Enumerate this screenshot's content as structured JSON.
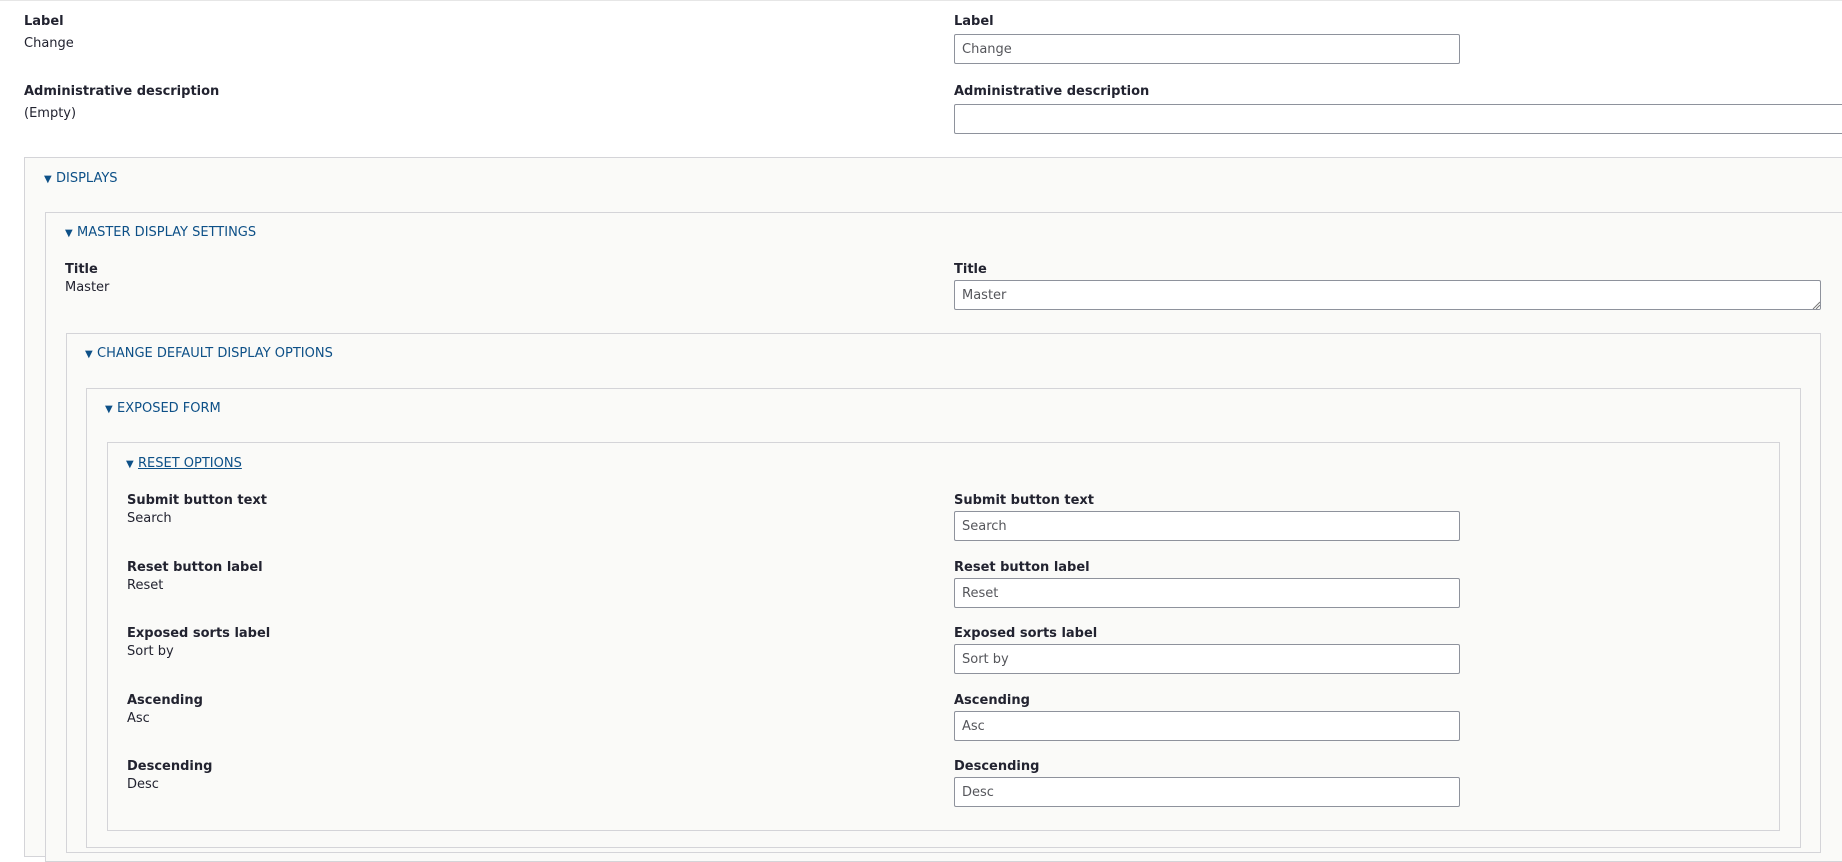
{
  "label": {
    "title": "Label",
    "value": "Change",
    "field_label": "Label",
    "field_value": "Change"
  },
  "admin_description": {
    "title": "Administrative description",
    "value": "(Empty)",
    "field_label": "Administrative description",
    "field_value": ""
  },
  "displays": {
    "summary": "DISPLAYS",
    "master": {
      "summary": "MASTER DISPLAY SETTINGS",
      "title_label": "Title",
      "title_value": "Master",
      "field_label": "Title",
      "field_value": "Master",
      "default_options": {
        "summary": "CHANGE DEFAULT DISPLAY OPTIONS",
        "exposed_form": {
          "summary": "EXPOSED FORM",
          "reset_options": {
            "summary": "RESET OPTIONS",
            "rows": [
              {
                "label": "Submit button text",
                "value": "Search",
                "field_label": "Submit button text",
                "field_value": "Search"
              },
              {
                "label": "Reset button label",
                "value": "Reset",
                "field_label": "Reset button label",
                "field_value": "Reset"
              },
              {
                "label": "Exposed sorts label",
                "value": "Sort by",
                "field_label": "Exposed sorts label",
                "field_value": "Sort by"
              },
              {
                "label": "Ascending",
                "value": "Asc",
                "field_label": "Ascending",
                "field_value": "Asc"
              },
              {
                "label": "Descending",
                "value": "Desc",
                "field_label": "Descending",
                "field_value": "Desc"
              }
            ]
          }
        }
      }
    }
  },
  "colors": {
    "link": "#003ecc",
    "border": "#8e929c",
    "panel_bg": "#fafaf8"
  },
  "icons": {
    "caret": "triangle-down-icon",
    "resize": "resize-grip-icon"
  }
}
